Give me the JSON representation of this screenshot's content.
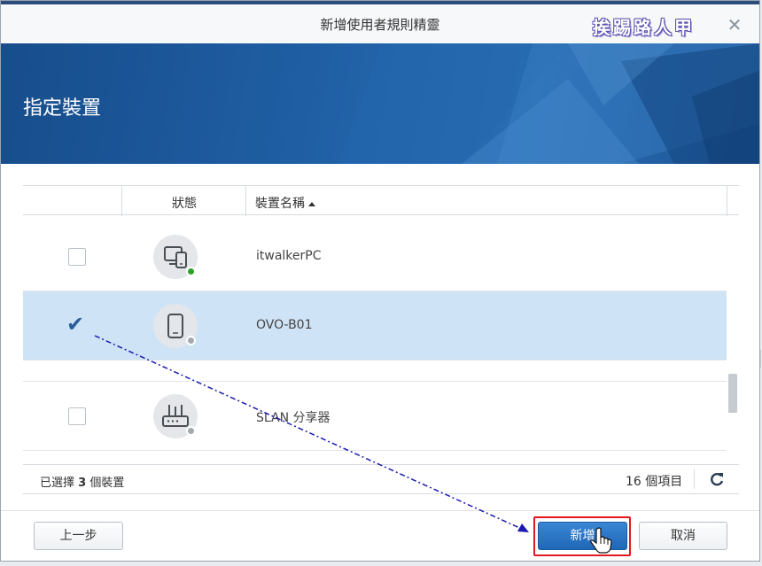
{
  "window": {
    "title": "新增使用者規則精靈",
    "watermark": "挨踢路人甲",
    "close_icon": "close-icon"
  },
  "banner": {
    "heading": "指定裝置"
  },
  "table": {
    "columns": {
      "status": "狀態",
      "device_name": "裝置名稱",
      "sort": "ascending"
    },
    "rows": [
      {
        "name": "itwalkerPC",
        "icon": "pc-phone-icon",
        "status": "online",
        "checked": false
      },
      {
        "name": "OVO-B01",
        "icon": "phone-icon",
        "status": "offline",
        "checked": true
      },
      {
        "name": "SLAN 分享器",
        "icon": "router-icon",
        "status": "offline",
        "checked": false
      }
    ]
  },
  "footer": {
    "selected_prefix": "已選擇",
    "selected_count": "3",
    "selected_suffix": "個裝置",
    "item_count": "16 個項目",
    "refresh_icon": "refresh-icon"
  },
  "buttons": {
    "prev": "上一步",
    "add": "新增",
    "cancel": "取消"
  },
  "colors": {
    "banner": "#1f5ea3",
    "selected_row": "#cfe3f6",
    "primary_button": "#2a77c9",
    "highlight": "#e0191f",
    "online": "#2aa32a",
    "offline": "#a3a9b0"
  }
}
